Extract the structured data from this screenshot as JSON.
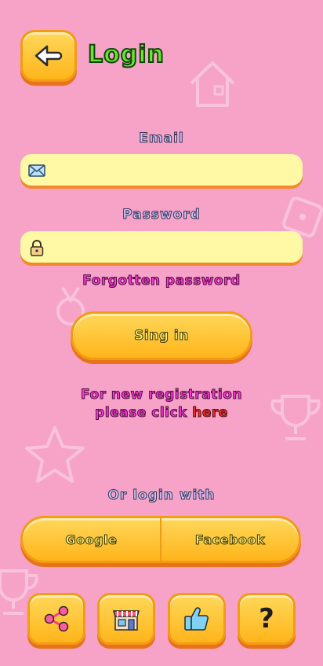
{
  "header": {
    "back_icon": "back-arrow-icon",
    "title": "Login"
  },
  "form": {
    "email_label": "Email",
    "email_value": "",
    "email_icon": "envelope-icon",
    "password_label": "Password",
    "password_value": "",
    "password_icon": "lock-icon",
    "forgot_link": "Forgotten password",
    "signin_label": "Sing in"
  },
  "registration": {
    "line1": "For new registration",
    "line2_prefix": "please click ",
    "link": "here"
  },
  "social": {
    "heading": "Or login with",
    "google_label": "Google",
    "facebook_label": "Facebook"
  },
  "bottom_bar": {
    "items": [
      "share-icon",
      "shop-icon",
      "thumbs-up-icon",
      "help-icon"
    ],
    "help_glyph": "?"
  },
  "colors": {
    "background": "#f7a3c8",
    "button": "#ffc22e",
    "title": "#66ea2a",
    "link": "#ff37d6",
    "here_link": "#ff2a2a",
    "field": "#fff8a4"
  }
}
